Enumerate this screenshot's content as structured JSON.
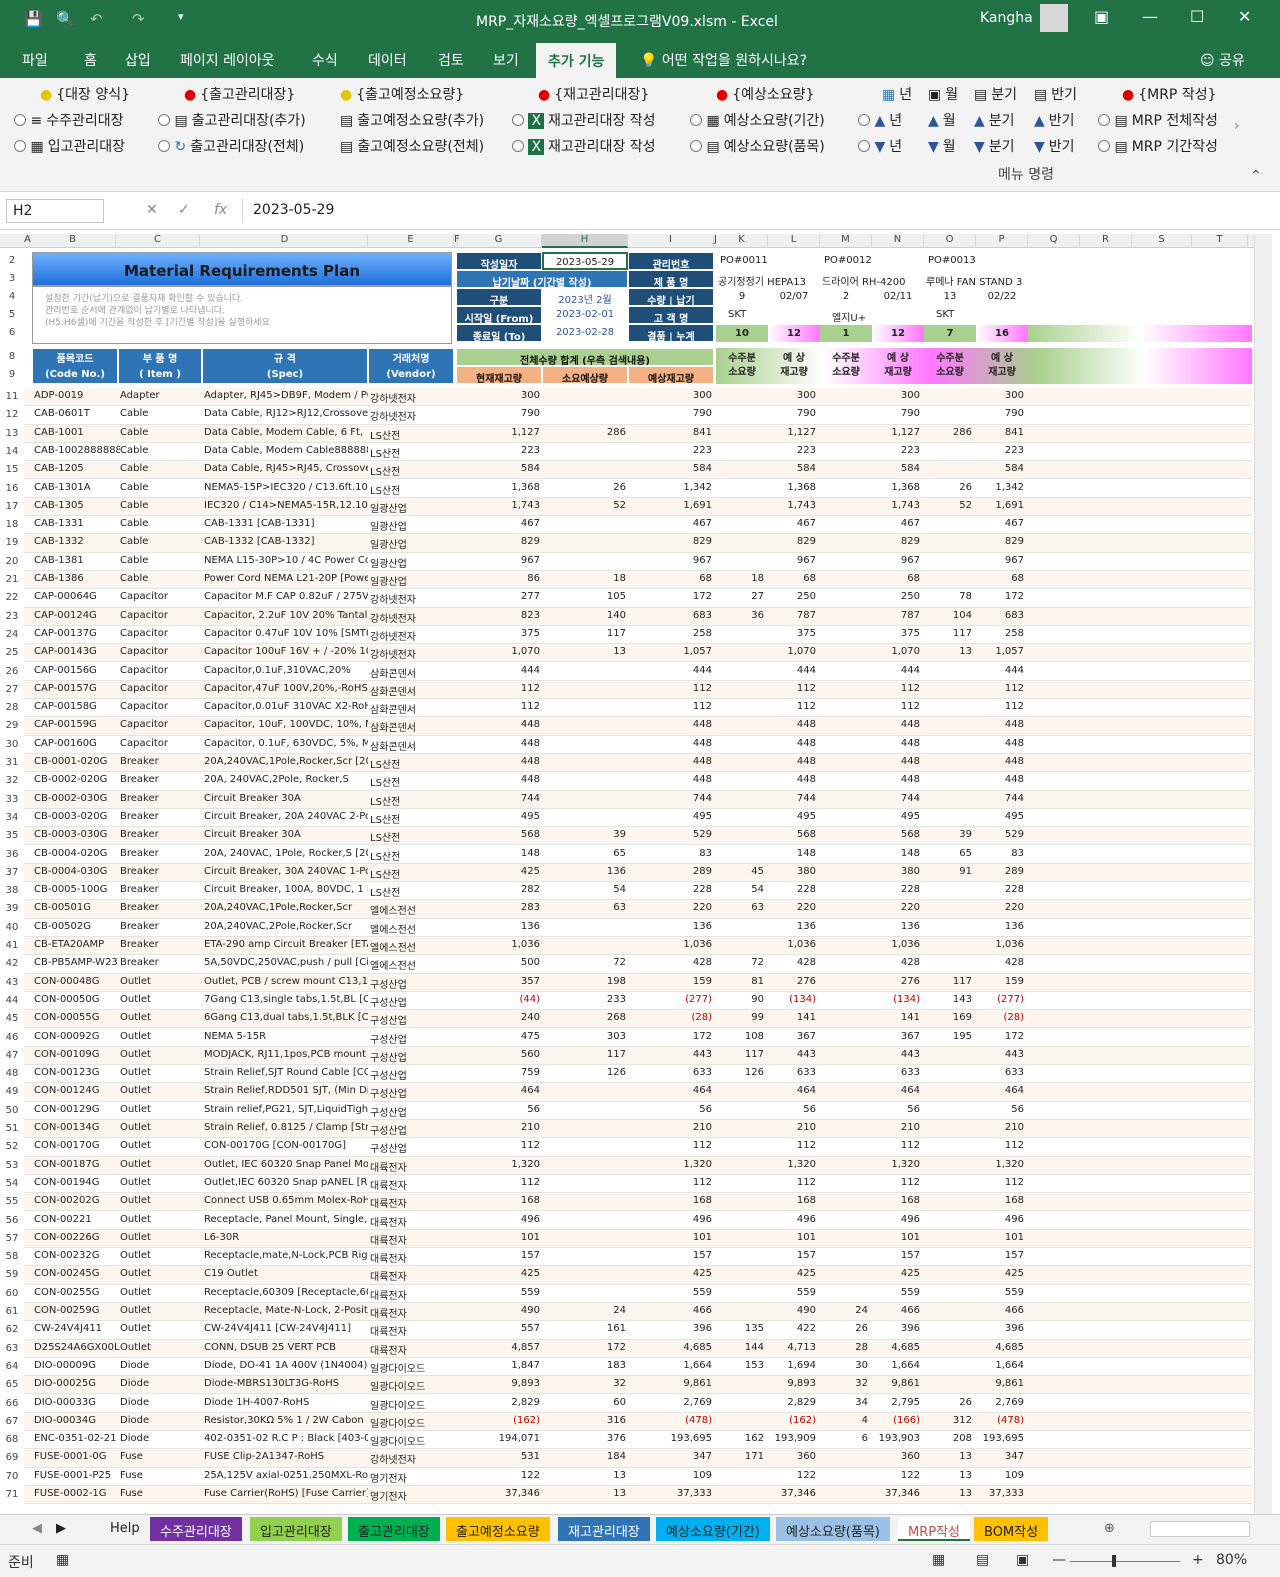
{
  "titlebar": {
    "title": "MRP_자재소요량_엑셀프로그램V09.xlsm  -  Excel",
    "user": "Kangha"
  },
  "tabs": [
    "파일",
    "홈",
    "삽입",
    "페이지 레이아웃",
    "수식",
    "데이터",
    "검토",
    "보기",
    "추가 기능",
    "어떤 작업을 원하시나요?",
    "공유"
  ],
  "ribbon": {
    "r1": [
      "{대장 양식}",
      "{출고관리대장}",
      "{출고예정소요량}",
      "{재고관리대장}",
      "{예상소요량}",
      "년",
      "월",
      "분기",
      "반기",
      "{MRP 작성}"
    ],
    "r2": [
      "수주관리대장",
      "출고관리대장(추가)",
      "출고예정소요량(추가)",
      "재고관리대장 작성",
      "예상소요량(기간)",
      "년",
      "월",
      "분기",
      "반기",
      "MRP 전체작성"
    ],
    "r3": [
      "입고관리대장",
      "출고관리대장(전체)",
      "출고예정소요량(전체)",
      "재고관리대장 작성",
      "예상소요량(품목)",
      "년",
      "월",
      "분기",
      "반기",
      "MRP 기간작성"
    ],
    "group": "메뉴 명령"
  },
  "namebox": "H2",
  "formula": "2023-05-29",
  "columns": [
    "A",
    "B",
    "C",
    "D",
    "E",
    "F",
    "G",
    "H",
    "I",
    "J",
    "K",
    "L",
    "M",
    "N",
    "O",
    "P",
    "Q",
    "R",
    "S",
    "T"
  ],
  "header": {
    "title": "Material Requirements Plan",
    "desc": [
      "설정한 기간(납기)으로 결품자재 확인할 수 있습니다.",
      "관리번호 순서에 관계없이 납기별로 나타냅니다.",
      "(H5:H6셀)에 기간을 작성한 후 [기간별 작성]을 실행하세요"
    ],
    "made": "작성일자",
    "made_val": "2023-05-29",
    "mgmt": "관리번호",
    "nap": "납기날짜 (기간별 작성)",
    "prod": "제 품 명",
    "gubun": "구분",
    "gubun_val": "2023년 2월",
    "qty": "수량 | 납기",
    "start": "시작일 (From)",
    "start_val": "2023-02-01",
    "cust": "고 객 명",
    "end": "종료일 (To)",
    "end_val": "2023-02-28",
    "res": "결품 | 누계",
    "po": [
      {
        "no": "PO#0011",
        "prod": "공기정정기 HEPA13",
        "qty": "9",
        "date": "02/07",
        "cust": "SKT",
        "a": "10",
        "b": "12"
      },
      {
        "no": "PO#0012",
        "prod": "드라이어 RH-4200",
        "qty": "2",
        "date": "02/11",
        "cust": "엘지U+",
        "a": "1",
        "b": "12"
      },
      {
        "no": "PO#0013",
        "prod": "루메나 FAN STAND 3",
        "qty": "13",
        "date": "02/22",
        "cust": "SKT",
        "a": "7",
        "b": "16"
      }
    ],
    "code": "품목코드",
    "code2": "(Code No.)",
    "item": "부 품 명",
    "item2": "( Item )",
    "spec": "규 격",
    "spec2": "(Spec)",
    "vendor": "거래처명",
    "vendor2": "(Vendor)",
    "total": "전체수량 합계 (우측 검색내용)",
    "cur": "현재재고량",
    "need": "소요예상량",
    "exp": "예상재고량",
    "sub": "수주분",
    "sub2": "소요량",
    "ex": "예 상",
    "ex2": "재고량"
  },
  "rows": [
    [
      "11",
      "ADP-0019",
      "Adapter",
      "Adapter, RJ45>DB9F, Modem / PC",
      "강하넷전자",
      "300",
      "",
      "300",
      "",
      "300",
      "",
      "300",
      "",
      "300"
    ],
    [
      "12",
      "CAB-0601T",
      "Cable",
      "Data Cable, RJ12>RJ12,Crossover",
      "강하넷전자",
      "790",
      "",
      "790",
      "",
      "790",
      "",
      "790",
      "",
      "790"
    ],
    [
      "13",
      "CAB-1001",
      "Cable",
      "Data Cable, Modem Cable, 6 Ft,",
      "LS산전",
      "1,127",
      "286",
      "841",
      "",
      "1,127",
      "",
      "1,127",
      "286",
      "841"
    ],
    [
      "14",
      "CAB-1002888888",
      "Cable",
      "Data Cable, Modem Cable888888",
      "LS산전",
      "223",
      "",
      "223",
      "",
      "223",
      "",
      "223",
      "",
      "223"
    ],
    [
      "15",
      "CAB-1205",
      "Cable",
      "Data Cable, RJ45>RJ45, Crossover",
      "LS산전",
      "584",
      "",
      "584",
      "",
      "584",
      "",
      "584",
      "",
      "584"
    ],
    [
      "16",
      "CAB-1301A",
      "Cable",
      "NEMA5-15P>IEC320 / C13.6ft.10A",
      "LS산전",
      "1,368",
      "26",
      "1,342",
      "",
      "1,368",
      "",
      "1,368",
      "26",
      "1,342"
    ],
    [
      "17",
      "CAB-1305",
      "Cable",
      "IEC320 / C14>NEMA5-15R,12.10A",
      "일광산업",
      "1,743",
      "52",
      "1,691",
      "",
      "1,743",
      "",
      "1,743",
      "52",
      "1,691"
    ],
    [
      "18",
      "CAB-1331",
      "Cable",
      "CAB-1331 [CAB-1331]",
      "일광산업",
      "467",
      "",
      "467",
      "",
      "467",
      "",
      "467",
      "",
      "467"
    ],
    [
      "19",
      "CAB-1332",
      "Cable",
      "CAB-1332 [CAB-1332]",
      "일광산업",
      "829",
      "",
      "829",
      "",
      "829",
      "",
      "829",
      "",
      "829"
    ],
    [
      "20",
      "CAB-1381",
      "Cable",
      "NEMA L15-30P>10 / 4C Power Co",
      "일광산업",
      "967",
      "",
      "967",
      "",
      "967",
      "",
      "967",
      "",
      "967"
    ],
    [
      "21",
      "CAB-1386",
      "Cable",
      "Power Cord NEMA L21-20P [Powe",
      "일광산업",
      "86",
      "18",
      "68",
      "18",
      "68",
      "",
      "68",
      "",
      "68"
    ],
    [
      "22",
      "CAP-00064G",
      "Capacitor",
      "Capacitor M.F CAP 0.82uF / 275V-",
      "강하넷전자",
      "277",
      "105",
      "172",
      "27",
      "250",
      "",
      "250",
      "78",
      "172"
    ],
    [
      "23",
      "CAP-00124G",
      "Capacitor",
      "Capacitor, 2.2uF 10V 20% Tantalu",
      "강하넷전자",
      "823",
      "140",
      "683",
      "36",
      "787",
      "",
      "787",
      "104",
      "683"
    ],
    [
      "24",
      "CAP-00137G",
      "Capacitor",
      "Capacitor 0.47uF 10V 10% [SMT0",
      "강하넷전자",
      "375",
      "117",
      "258",
      "",
      "375",
      "",
      "375",
      "117",
      "258"
    ],
    [
      "25",
      "CAP-00143G",
      "Capacitor",
      "Capacitor 100uF 16V + / -20% 10",
      "강하넷전자",
      "1,070",
      "13",
      "1,057",
      "",
      "1,070",
      "",
      "1,070",
      "13",
      "1,057"
    ],
    [
      "26",
      "CAP-00156G",
      "Capacitor",
      "Capacitor,0.1uF,310VAC,20%",
      "삼화콘덴서",
      "444",
      "",
      "444",
      "",
      "444",
      "",
      "444",
      "",
      "444"
    ],
    [
      "27",
      "CAP-00157G",
      "Capacitor",
      "Capacitor,47uF 100V,20%,-RoHS",
      "삼화콘덴서",
      "112",
      "",
      "112",
      "",
      "112",
      "",
      "112",
      "",
      "112"
    ],
    [
      "28",
      "CAP-00158G",
      "Capacitor",
      "Capacitor,0.01uF 310VAC X2-RoH",
      "삼화콘덴서",
      "112",
      "",
      "112",
      "",
      "112",
      "",
      "112",
      "",
      "112"
    ],
    [
      "29",
      "CAP-00159G",
      "Capacitor",
      "Capacitor, 10uF, 100VDC, 10%, M",
      "삼화콘덴서",
      "448",
      "",
      "448",
      "",
      "448",
      "",
      "448",
      "",
      "448"
    ],
    [
      "30",
      "CAP-00160G",
      "Capacitor",
      "Capacitor, 0.1uF, 630VDC, 5%, Me",
      "삼화콘덴서",
      "448",
      "",
      "448",
      "",
      "448",
      "",
      "448",
      "",
      "448"
    ],
    [
      "31",
      "CB-0001-020G",
      "Breaker",
      "20A,240VAC,1Pole,Rocker,Scr [20A",
      "LS산전",
      "448",
      "",
      "448",
      "",
      "448",
      "",
      "448",
      "",
      "448"
    ],
    [
      "32",
      "CB-0002-020G",
      "Breaker",
      "20A, 240VAC,2Pole, Rocker,S",
      "LS산전",
      "448",
      "",
      "448",
      "",
      "448",
      "",
      "448",
      "",
      "448"
    ],
    [
      "33",
      "CB-0002-030G",
      "Breaker",
      "Circuit Breaker 30A",
      "LS산전",
      "744",
      "",
      "744",
      "",
      "744",
      "",
      "744",
      "",
      "744"
    ],
    [
      "34",
      "CB-0003-020G",
      "Breaker",
      "Circuit Breaker, 20A 240VAC 2-Po",
      "LS산전",
      "495",
      "",
      "495",
      "",
      "495",
      "",
      "495",
      "",
      "495"
    ],
    [
      "35",
      "CB-0003-030G",
      "Breaker",
      "Circuit Breaker 30A",
      "LS산전",
      "568",
      "39",
      "529",
      "",
      "568",
      "",
      "568",
      "39",
      "529"
    ],
    [
      "36",
      "CB-0004-020G",
      "Breaker",
      "20A, 240VAC, 1Pole, Rocker,S [20A",
      "LS산전",
      "148",
      "65",
      "83",
      "",
      "148",
      "",
      "148",
      "65",
      "83"
    ],
    [
      "37",
      "CB-0004-030G",
      "Breaker",
      "Circuit Breaker, 30A 240VAC 1-Po",
      "LS산전",
      "425",
      "136",
      "289",
      "45",
      "380",
      "",
      "380",
      "91",
      "289"
    ],
    [
      "38",
      "CB-0005-100G",
      "Breaker",
      "Circuit Breaker, 100A, 80VDC, 1 Po",
      "LS산전",
      "282",
      "54",
      "228",
      "54",
      "228",
      "",
      "228",
      "",
      "228"
    ],
    [
      "39",
      "CB-00501G",
      "Breaker",
      "20A,240VAC,1Pole,Rocker,Scr",
      "엘에스전선",
      "283",
      "63",
      "220",
      "63",
      "220",
      "",
      "220",
      "",
      "220"
    ],
    [
      "40",
      "CB-00502G",
      "Breaker",
      "20A,240VAC,2Pole,Rocker,Scr",
      "엘에스전선",
      "136",
      "",
      "136",
      "",
      "136",
      "",
      "136",
      "",
      "136"
    ],
    [
      "41",
      "CB-ETA20AMP",
      "Breaker",
      "ETA-290 amp Circuit Breaker [ETA",
      "엘에스전선",
      "1,036",
      "",
      "1,036",
      "",
      "1,036",
      "",
      "1,036",
      "",
      "1,036"
    ],
    [
      "42",
      "CB-PB5AMP-W23",
      "Breaker",
      "5A,50VDC,250VAC,push / pull [Circ",
      "엘에스전선",
      "500",
      "72",
      "428",
      "72",
      "428",
      "",
      "428",
      "",
      "428"
    ],
    [
      "43",
      "CON-00048G",
      "Outlet",
      "Outlet, PCB / screw mount C13,10",
      "구성산업",
      "357",
      "198",
      "159",
      "81",
      "276",
      "",
      "276",
      "117",
      "159"
    ],
    [
      "44",
      "CON-00050G",
      "Outlet",
      "7Gang C13,single tabs,1.5t,BL [CO",
      "구성산업",
      "(44)",
      "233",
      "(277)",
      "90",
      "(134)",
      "",
      "(134)",
      "143",
      "(277)"
    ],
    [
      "45",
      "CON-00055G",
      "Outlet",
      "6Gang C13,dual tabs,1.5t,BLK [CO",
      "구성산업",
      "240",
      "268",
      "(28)",
      "99",
      "141",
      "",
      "141",
      "169",
      "(28)"
    ],
    [
      "46",
      "CON-00092G",
      "Outlet",
      "NEMA 5-15R",
      "구성산업",
      "475",
      "303",
      "172",
      "108",
      "367",
      "",
      "367",
      "195",
      "172"
    ],
    [
      "47",
      "CON-00109G",
      "Outlet",
      "MODJACK, RJ11,1pos,PCB mount",
      "구성산업",
      "560",
      "117",
      "443",
      "117",
      "443",
      "",
      "443",
      "",
      "443"
    ],
    [
      "48",
      "CON-00123G",
      "Outlet",
      "Strain Relief,SJT Round Cable [CO",
      "구성산업",
      "759",
      "126",
      "633",
      "126",
      "633",
      "",
      "633",
      "",
      "633"
    ],
    [
      "49",
      "CON-00124G",
      "Outlet",
      "Strain Relief,RDD501 SJT, (Min Dia",
      "구성산업",
      "464",
      "",
      "464",
      "",
      "464",
      "",
      "464",
      "",
      "464"
    ],
    [
      "50",
      "CON-00129G",
      "Outlet",
      "Strain relief,PG21, SJT,LiquidTight",
      "구성산업",
      "56",
      "",
      "56",
      "",
      "56",
      "",
      "56",
      "",
      "56"
    ],
    [
      "51",
      "CON-00134G",
      "Outlet",
      "Strain Relief, 0.8125 / Clamp [Stra",
      "구성산업",
      "210",
      "",
      "210",
      "",
      "210",
      "",
      "210",
      "",
      "210"
    ],
    [
      "52",
      "CON-00170G",
      "Outlet",
      "CON-00170G [CON-00170G]",
      "구성산업",
      "112",
      "",
      "112",
      "",
      "112",
      "",
      "112",
      "",
      "112"
    ],
    [
      "53",
      "CON-00187G",
      "Outlet",
      "Outlet, IEC 60320 Snap Panel Mo",
      "대륙전자",
      "1,320",
      "",
      "1,320",
      "",
      "1,320",
      "",
      "1,320",
      "",
      "1,320"
    ],
    [
      "54",
      "CON-00194G",
      "Outlet",
      "Outlet,IEC 60320 Snap pANEL [R3",
      "대륙전자",
      "112",
      "",
      "112",
      "",
      "112",
      "",
      "112",
      "",
      "112"
    ],
    [
      "55",
      "CON-00202G",
      "Outlet",
      "Connect USB 0.65mm Molex-RoH",
      "대륙전자",
      "168",
      "",
      "168",
      "",
      "168",
      "",
      "168",
      "",
      "168"
    ],
    [
      "56",
      "CON-00221",
      "Outlet",
      "Receptacle, Panel Mount, Single,",
      "대륙전자",
      "496",
      "",
      "496",
      "",
      "496",
      "",
      "496",
      "",
      "496"
    ],
    [
      "57",
      "CON-00226G",
      "Outlet",
      "L6-30R",
      "대륙전자",
      "101",
      "",
      "101",
      "",
      "101",
      "",
      "101",
      "",
      "101"
    ],
    [
      "58",
      "CON-00232G",
      "Outlet",
      "Receptacle,mate,N-Lock,PCB Right",
      "대륙전자",
      "157",
      "",
      "157",
      "",
      "157",
      "",
      "157",
      "",
      "157"
    ],
    [
      "59",
      "CON-00245G",
      "Outlet",
      "C19 Outlet",
      "대륙전자",
      "425",
      "",
      "425",
      "",
      "425",
      "",
      "425",
      "",
      "425"
    ],
    [
      "60",
      "CON-00255G",
      "Outlet",
      "Receptacle,60309 [Receptacle,603",
      "대륙전자",
      "559",
      "",
      "559",
      "",
      "559",
      "",
      "559",
      "",
      "559"
    ],
    [
      "61",
      "CON-00259G",
      "Outlet",
      "Receptacle, Mate-N-Lock, 2-Positi",
      "대륙전자",
      "490",
      "24",
      "466",
      "",
      "490",
      "24",
      "466",
      "",
      "466"
    ],
    [
      "62",
      "CW-24V4J411",
      "Outlet",
      "CW-24V4J411 [CW-24V4J411]",
      "대륙전자",
      "557",
      "161",
      "396",
      "135",
      "422",
      "26",
      "396",
      "",
      "396"
    ],
    [
      "63",
      "D25S24A6GX00LI",
      "Outlet",
      "CONN, DSUB 25 VERT PCB",
      "대륙전자",
      "4,857",
      "172",
      "4,685",
      "144",
      "4,713",
      "28",
      "4,685",
      "",
      "4,685"
    ],
    [
      "64",
      "DIO-00009G",
      "Diode",
      "Diode, DO-41 1A 400V (1N4004)-R",
      "일광다이오드",
      "1,847",
      "183",
      "1,664",
      "153",
      "1,694",
      "30",
      "1,664",
      "",
      "1,664"
    ],
    [
      "65",
      "DIO-00025G",
      "Diode",
      "Diode-MBRS130LT3G-RoHS",
      "일광다이오드",
      "9,893",
      "32",
      "9,861",
      "",
      "9,893",
      "32",
      "9,861",
      "",
      "9,861"
    ],
    [
      "66",
      "DIO-00033G",
      "Diode",
      "Diode 1H-4007-RoHS",
      "일광다이오드",
      "2,829",
      "60",
      "2,769",
      "",
      "2,829",
      "34",
      "2,795",
      "26",
      "2,769"
    ],
    [
      "67",
      "DIO-00034G",
      "Diode",
      "Resistor,30KΩ 5% 1 / 2W Cabon",
      "일광다이오드",
      "(162)",
      "316",
      "(478)",
      "",
      "(162)",
      "4",
      "(166)",
      "312",
      "(478)"
    ],
    [
      "68",
      "ENC-0351-02-21",
      "Diode",
      "402-0351-02 R.C P : Black [403-035",
      "일광다이오드",
      "194,071",
      "376",
      "193,695",
      "162",
      "193,909",
      "6",
      "193,903",
      "208",
      "193,695"
    ],
    [
      "69",
      "FUSE-0001-0G",
      "Fuse",
      "FUSE Clip-2A1347-RoHS",
      "강하넷전자",
      "531",
      "184",
      "347",
      "171",
      "360",
      "",
      "360",
      "13",
      "347"
    ],
    [
      "70",
      "FUSE-0001-P25",
      "Fuse",
      "25A,125V axial-0251.250MXL-RoH",
      "영기전자",
      "122",
      "13",
      "109",
      "",
      "122",
      "",
      "122",
      "13",
      "109"
    ],
    [
      "71",
      "FUSE-0002-1G",
      "Fuse",
      "Fuse Carrier(RoHS) [Fuse Carrier]",
      "영기전자",
      "37,346",
      "13",
      "37,333",
      "",
      "37,346",
      "",
      "37,346",
      "13",
      "37,333"
    ]
  ],
  "sheets": [
    "Help",
    "수주관리대장",
    "입고관리대장",
    "출고관리대장",
    "출고예정소요량",
    "재고관리대장",
    "예상소요량(기간)",
    "예상소요량(품목)",
    "MRP작성",
    "BOM작성"
  ],
  "status": {
    "ready": "준비",
    "zoom": "80%"
  }
}
